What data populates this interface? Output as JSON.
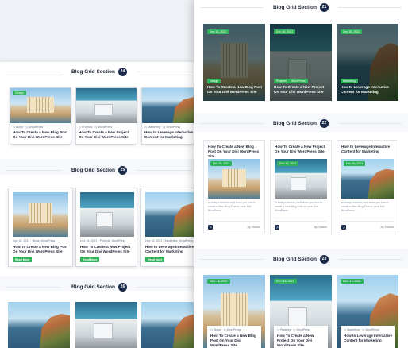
{
  "posts": {
    "p1_title": "How To Create a New Blog Post On Your Divi WordPress Site",
    "p2_title": "How To Create a New Project On Your Divi WordPress Site",
    "p3_title": "How to Leverage Interactive Content for Marketing"
  },
  "categories": {
    "design": "Design",
    "projects": "Projects",
    "wordpress": "WordPress",
    "marketing": "Marketing",
    "blogs_wp": "Blogs, WordPress",
    "projects_wp": "Projects, WordPress",
    "marketing_wp": "Marketing, WordPress",
    "blogs_wp_icon": "◷ Blogs · ◷ WordPress",
    "projects_wp_icon": "◷ Projects · ◷ WordPress",
    "marketing_wp_icon": "◷ Marketing · ◷ WordPress"
  },
  "dates": {
    "d1": "Dec 16, 2021",
    "d1_upper": "DEC 16, 2021"
  },
  "labels": {
    "read_more": "Read More",
    "by_sharon": "by Sharon"
  },
  "excerpt": "In today's tutorial, we'll show you how to create a New Blog Post on your Divi WordPress...",
  "sections": {
    "s24": {
      "title": "Blog Grid Section",
      "num": "24"
    },
    "s25": {
      "title": "Blog Grid Section",
      "num": "25"
    },
    "s26": {
      "title": "Blog Grid Section",
      "num": "26"
    },
    "s21": {
      "title": "Blog Grid Section",
      "num": "21"
    },
    "s22": {
      "title": "Blog Grid Section",
      "num": "22"
    },
    "s23": {
      "title": "Blog Grid Section",
      "num": "23"
    }
  },
  "colors": {
    "accent": "#2eb35a",
    "navy": "#1b2a4a",
    "dark_card": "#14221d"
  }
}
